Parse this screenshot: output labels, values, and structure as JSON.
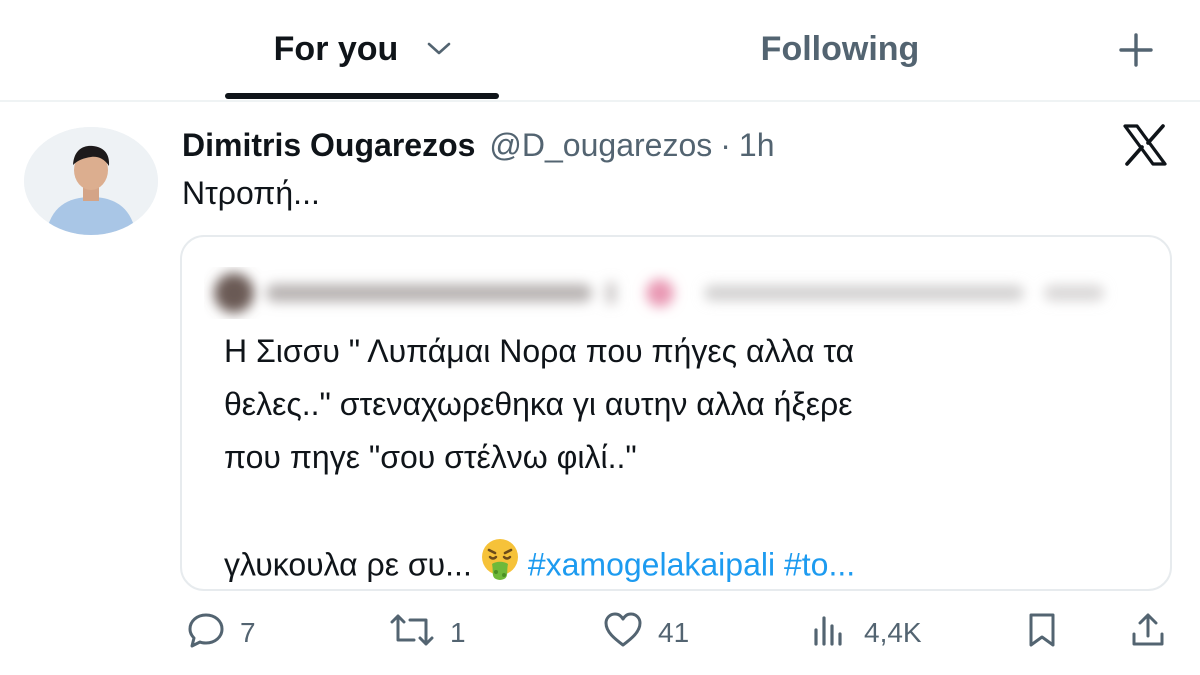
{
  "tabs": {
    "for_you": "For you",
    "following": "Following"
  },
  "tweet": {
    "author_name": "Dimitris Ougarezos",
    "handle": "@D_ougarezos",
    "separator": "·",
    "time": "1h",
    "text": "Ντροπή..."
  },
  "quote": {
    "lines": [
      "Η Σισσυ \" Λυπάμαι Νορα που πήγες αλλα τα",
      "θελες..\" στεναχωρεθηκα γι αυτην αλλα ήξερε",
      "που πηγε \"σου στέλνω φιλί..\""
    ],
    "last_prefix": "γλυκουλα ρε συ...",
    "hashtags": "#xamogelakaipali #to..."
  },
  "actions": {
    "replies": "7",
    "reposts": "1",
    "likes": "41",
    "views": "4,4K"
  },
  "icons": {
    "tab_dropdown": "chevron-down-icon",
    "compose": "plus-icon",
    "brand": "x-logo-icon",
    "reply": "reply-icon",
    "repost": "repost-icon",
    "like": "heart-icon",
    "views": "views-icon",
    "bookmark": "bookmark-icon",
    "share": "share-icon",
    "emoji": "nauseated-face-emoji"
  },
  "colors": {
    "text": "#0f1419",
    "secondary": "#536471",
    "link": "#1d9bf0",
    "border": "#e7ebee"
  }
}
